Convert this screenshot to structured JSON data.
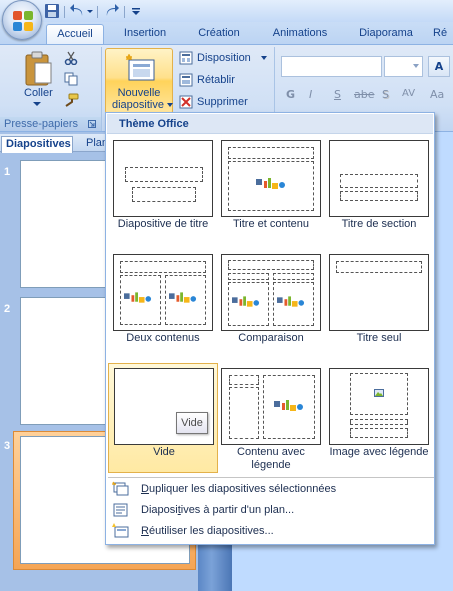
{
  "ribbon": {
    "tabs": [
      {
        "label": "Accueil",
        "active": true
      },
      {
        "label": "Insertion"
      },
      {
        "label": "Création"
      },
      {
        "label": "Animations"
      },
      {
        "label": "Diaporama"
      },
      {
        "label": "Ré"
      }
    ],
    "clipboard": {
      "paste_label": "Coller",
      "group_label": "Presse-papiers"
    },
    "slides_group": {
      "new_slide_line1": "Nouvelle",
      "new_slide_line2": "diapositive",
      "layout_label": "Disposition",
      "reset_label": "Rétablir",
      "delete_label": "Supprimer"
    },
    "font_buttons": [
      "G",
      "I",
      "S",
      "abe",
      "S",
      "AV",
      "Aa"
    ]
  },
  "left_pane": {
    "tabs": [
      "Diapositives",
      "Plan"
    ],
    "slides": [
      {
        "number": "1"
      },
      {
        "number": "2"
      },
      {
        "number": "3",
        "selected": true
      }
    ]
  },
  "gallery": {
    "header": "Thème Office",
    "layouts": [
      {
        "label": "Diapositive de titre"
      },
      {
        "label": "Titre et contenu"
      },
      {
        "label": "Titre de section"
      },
      {
        "label": "Deux contenus"
      },
      {
        "label": "Comparaison"
      },
      {
        "label": "Titre seul"
      },
      {
        "label": "Vide",
        "hover": true
      },
      {
        "label": "Contenu avec légende"
      },
      {
        "label": "Image avec légende"
      }
    ],
    "tooltip": "Vide",
    "menu_items": [
      {
        "label": "Dupliquer les diapositives sélectionnées"
      },
      {
        "label": "Diapositives à partir d'un plan..."
      },
      {
        "label": "Réutiliser les diapositives..."
      }
    ]
  }
}
